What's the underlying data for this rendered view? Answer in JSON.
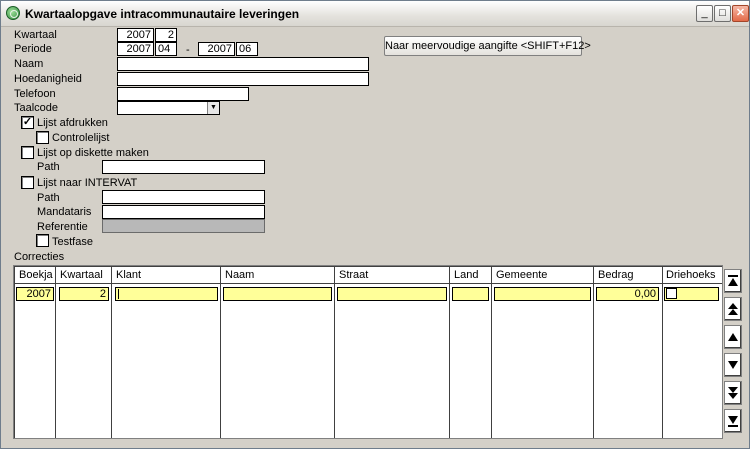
{
  "window": {
    "title": "Kwartaalopgave intracommunautaire leveringen",
    "controls": {
      "minimize": "_",
      "maximize": "□",
      "close": "✕"
    }
  },
  "form": {
    "kwartaal": {
      "label": "Kwartaal",
      "year": "2007",
      "quarter": "2"
    },
    "periode": {
      "label": "Periode",
      "from_year": "2007",
      "from_month": "04",
      "separator": "-",
      "to_year": "2007",
      "to_month": "06"
    },
    "naam": {
      "label": "Naam",
      "value": ""
    },
    "hoedanigheid": {
      "label": "Hoedanigheid",
      "value": ""
    },
    "telefoon": {
      "label": "Telefoon",
      "value": ""
    },
    "taalcode": {
      "label": "Taalcode",
      "value": ""
    },
    "lijst_afdrukken": {
      "label": "Lijst afdrukken",
      "checked": true
    },
    "controlelijst": {
      "label": "Controlelijst",
      "checked": false
    },
    "diskette": {
      "label": "Lijst op diskette maken",
      "checked": false,
      "path_label": "Path",
      "path_value": ""
    },
    "intervat": {
      "label": "Lijst naar INTERVAT",
      "checked": false,
      "path_label": "Path",
      "path_value": "",
      "mandataris_label": "Mandataris",
      "mandataris_value": "",
      "referentie_label": "Referentie",
      "referentie_value": ""
    },
    "testfase": {
      "label": "Testfase",
      "checked": false
    },
    "multi_button": "Naar meervoudige aangifte <SHIFT+F12>"
  },
  "correcties": {
    "label": "Correcties",
    "columns": [
      "Boekja",
      "Kwartaal",
      "Klant",
      "Naam",
      "Straat",
      "Land",
      "Gemeente",
      "Bedrag",
      "Driehoeks"
    ],
    "rows": [
      {
        "boekjaar": "2007",
        "kwartaal": "2",
        "klant": "",
        "naam": "",
        "straat": "",
        "land": "",
        "gemeente": "",
        "bedrag": "0,00",
        "driehoeks": false
      }
    ]
  },
  "scroll_icons": [
    "first-record-icon",
    "page-up-icon",
    "previous-record-icon",
    "next-record-icon",
    "page-down-icon",
    "last-record-icon"
  ]
}
